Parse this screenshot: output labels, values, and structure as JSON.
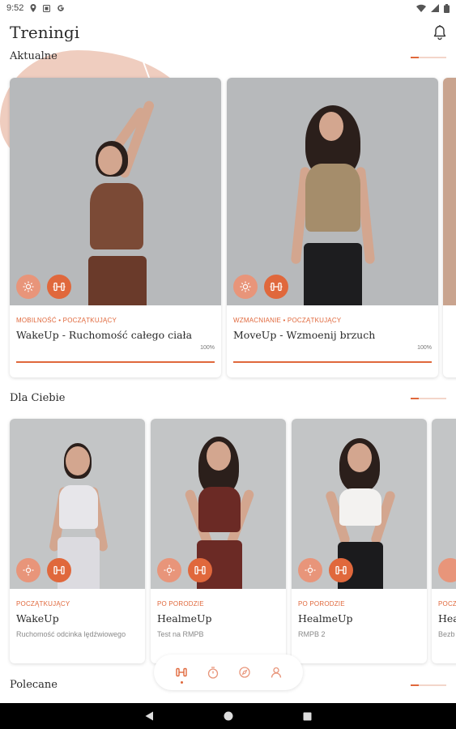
{
  "status_bar": {
    "time": "9:52"
  },
  "header": {
    "title": "Treningi",
    "bell_icon": "bell-icon"
  },
  "sections": {
    "current": {
      "title": "Aktualne",
      "cards": [
        {
          "tags": "MOBILNOŚĆ • POCZĄTKUJĄCY",
          "name": "WakeUp - Ruchomość całego ciała",
          "percent": "100%",
          "progress": 1.0
        },
        {
          "tags": "WZMACNIANIE • POCZĄTKUJĄCY",
          "name": "MoveUp - Wzmoenij brzuch",
          "percent": "100%",
          "progress": 1.0
        }
      ]
    },
    "for_you": {
      "title": "Dla Ciebie",
      "cards": [
        {
          "tags": "POCZĄTKUJĄCY",
          "name": "WakeUp",
          "subtitle": "Ruchomość odcinka lędźwiowego"
        },
        {
          "tags": "PO PORODZIE",
          "name": "HealmeUp",
          "subtitle": "Test na RMPB"
        },
        {
          "tags": "PO PORODZIE",
          "name": "HealmeUp",
          "subtitle": "RMPB 2"
        },
        {
          "tags": "POCZ",
          "name": "Hea",
          "subtitle": "Bezb"
        }
      ]
    },
    "recommended": {
      "title": "Polecane"
    }
  },
  "bottom_nav": {
    "items": [
      "workouts-icon",
      "timer-icon",
      "compass-icon",
      "profile-icon"
    ],
    "active_index": 0
  },
  "colors": {
    "accent": "#e0683c",
    "accent_light": "#e8957a",
    "blob": "#efcdbf"
  }
}
